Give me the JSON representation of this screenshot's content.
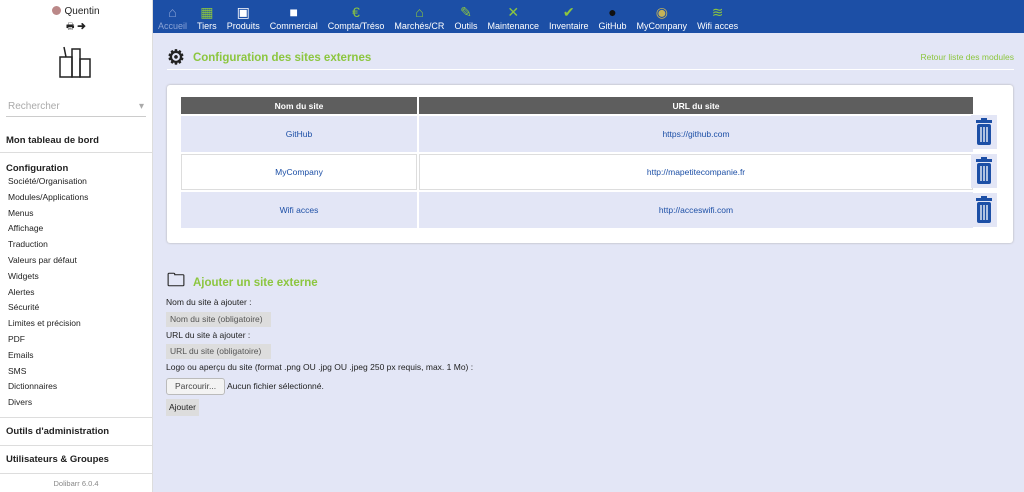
{
  "user": {
    "name": "Quentin"
  },
  "sidebar": {
    "search_placeholder": "Rechercher",
    "dashboard": "Mon tableau de bord",
    "config_title": "Configuration",
    "items": [
      "Société/Organisation",
      "Modules/Applications",
      "Menus",
      "Affichage",
      "Traduction",
      "Valeurs par défaut",
      "Widgets",
      "Alertes",
      "Sécurité",
      "Limites et précision",
      "PDF",
      "Emails",
      "SMS",
      "Dictionnaires",
      "Divers"
    ],
    "admin_tools": "Outils d'administration",
    "users_groups": "Utilisateurs & Groupes",
    "version": "Dolibarr 6.0.4"
  },
  "topnav": [
    {
      "label": "Accueil",
      "icon": "home-icon",
      "glyph": "⌂"
    },
    {
      "label": "Tiers",
      "icon": "building-icon",
      "glyph": "▦"
    },
    {
      "label": "Produits",
      "icon": "image-icon",
      "glyph": "▣"
    },
    {
      "label": "Commercial",
      "icon": "briefcase-icon",
      "glyph": "■"
    },
    {
      "label": "Compta/Tréso",
      "icon": "euro-icon",
      "glyph": "€"
    },
    {
      "label": "Marchés/CR",
      "icon": "bank-icon",
      "glyph": "⌂"
    },
    {
      "label": "Outils",
      "icon": "pencil-icon",
      "glyph": "✎"
    },
    {
      "label": "Maintenance",
      "icon": "tools-icon",
      "glyph": "✕"
    },
    {
      "label": "Inventaire",
      "icon": "inventory-icon",
      "glyph": "✔"
    },
    {
      "label": "GitHub",
      "icon": "github-icon",
      "glyph": "●"
    },
    {
      "label": "MyCompany",
      "icon": "mycompany-icon",
      "glyph": "◉"
    },
    {
      "label": "Wifi acces",
      "icon": "wifi-icon",
      "glyph": "≋"
    }
  ],
  "page": {
    "title": "Configuration des sites externes",
    "back": "Retour liste des modules"
  },
  "table": {
    "headers": [
      "Nom du site",
      "URL du site"
    ],
    "rows": [
      {
        "name": "GitHub",
        "url": "https://github.com"
      },
      {
        "name": "MyCompany",
        "url": "http://mapetitecompanie.fr"
      },
      {
        "name": "Wifi acces",
        "url": "http://acceswifi.com"
      }
    ]
  },
  "form": {
    "title": "Ajouter un site externe",
    "name_label": "Nom du site à ajouter :",
    "name_placeholder": "Nom du site (obligatoire)",
    "url_label": "URL du site à ajouter :",
    "url_placeholder": "URL du site (obligatoire)",
    "logo_label": "Logo ou aperçu du site (format .png OU .jpg OU .jpeg 250 px requis, max. 1 Mo) :",
    "browse": "Parcourir...",
    "no_file": "Aucun fichier sélectionné.",
    "submit": "Ajouter"
  }
}
